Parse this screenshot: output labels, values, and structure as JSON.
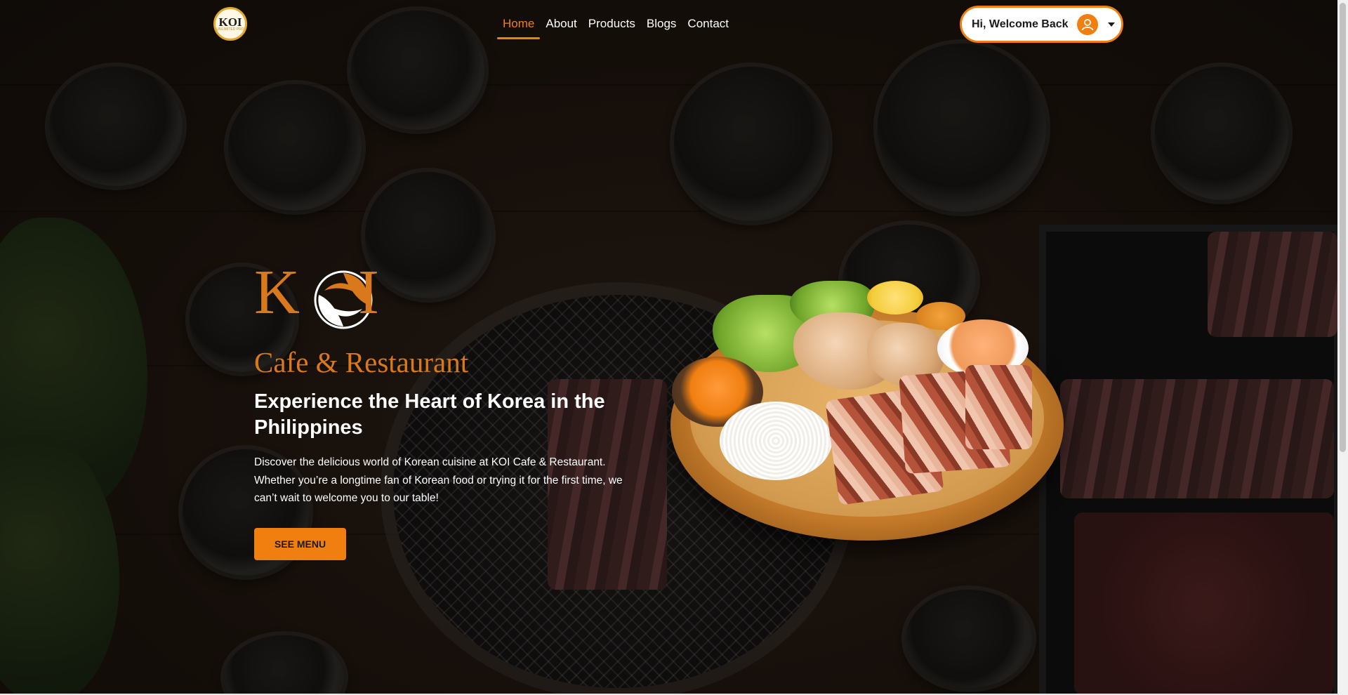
{
  "header": {
    "logo": {
      "text": "KOI",
      "subtext": "UNLIMITED PRO"
    },
    "nav": [
      {
        "label": "Home",
        "active": true
      },
      {
        "label": "About",
        "active": false
      },
      {
        "label": "Products",
        "active": false
      },
      {
        "label": "Blogs",
        "active": false
      },
      {
        "label": "Contact",
        "active": false
      }
    ],
    "user_menu": {
      "label": "Hi, Welcome Back",
      "icon": "user-icon",
      "caret": "chevron-down-icon"
    }
  },
  "hero": {
    "brand_letters": {
      "k": "K",
      "i": "I"
    },
    "subtitle": "Cafe & Restaurant",
    "headline": "Experience the Heart of Korea in the Philippines",
    "description": "Discover the delicious world of Korean cuisine at KOI Cafe & Restaurant. Whether you’re a longtime fan of Korean food or trying it for the first time, we can’t wait to welcome you to our table!",
    "cta_label": "SEE MENU"
  },
  "colors": {
    "accent": "#f07f10",
    "brand": "#d9791b",
    "text": "#ffffff"
  }
}
